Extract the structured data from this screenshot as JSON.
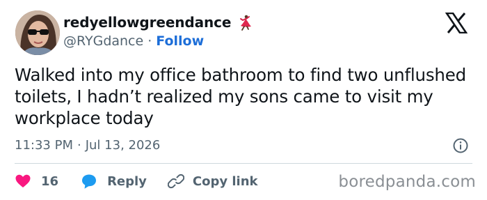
{
  "user": {
    "display_name": "redyellowgreendance",
    "handle": "@RYGdance",
    "separator": "·",
    "follow_label": "Follow",
    "emoji_icon": "dancer-emoji"
  },
  "post": {
    "text": "Walked into my office bathroom to find two unflushed toilets, I hadn’t realized my sons came to visit my workplace today",
    "time": "11:33 PM",
    "meta_separator": "·",
    "date": "Jul 13, 2026"
  },
  "actions": {
    "like_count": "16",
    "reply_label": "Reply",
    "copy_link_label": "Copy link"
  },
  "watermark": "boredpanda.com",
  "colors": {
    "accent": "#1d6ed8",
    "like": "#f91880",
    "reply": "#1d9bf0",
    "muted": "#536471"
  }
}
